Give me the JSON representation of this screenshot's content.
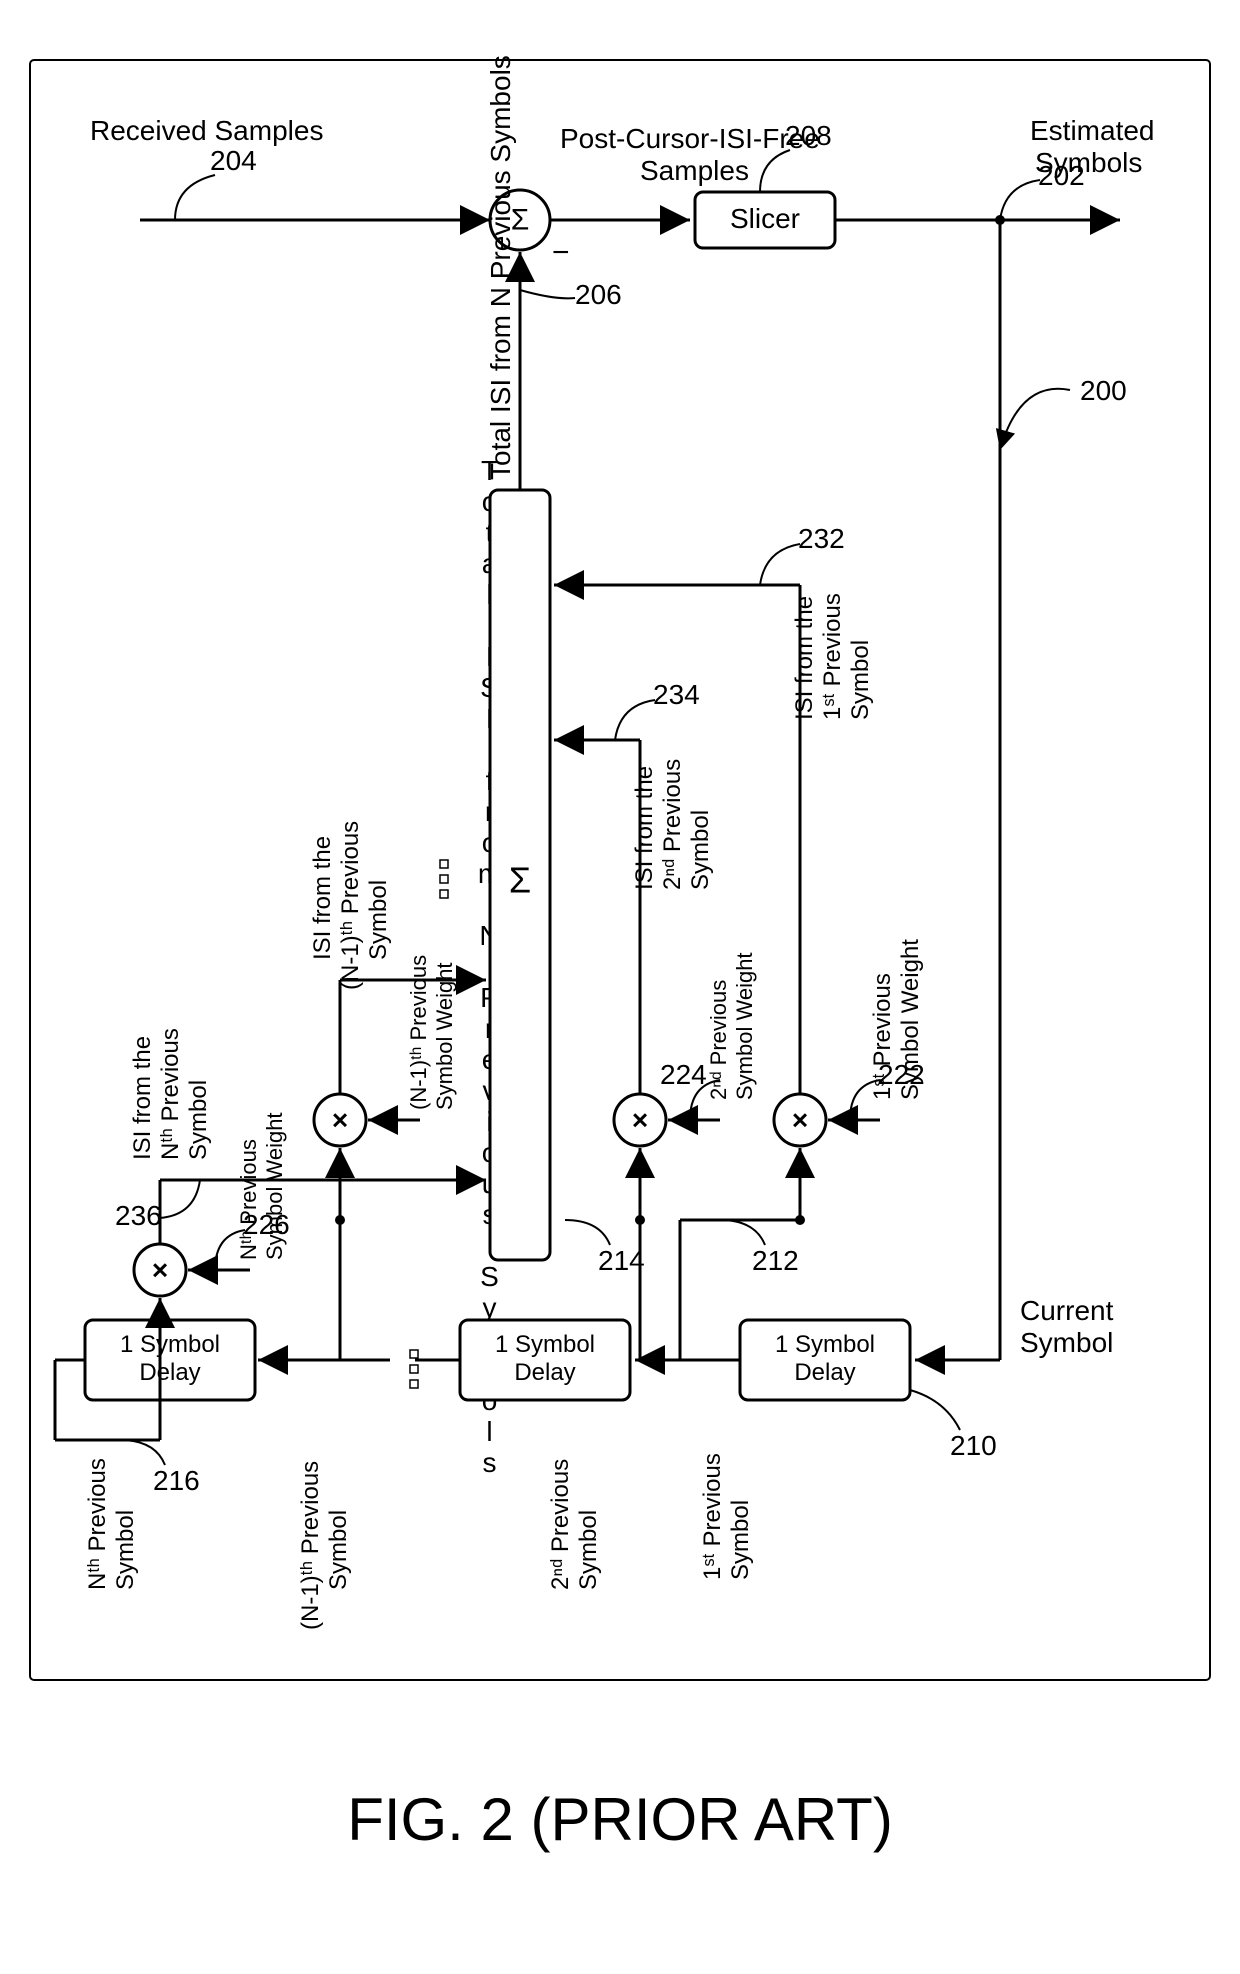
{
  "labels": {
    "received_samples": "Received\nSamples",
    "estimated_symbols": "Estimated\nSymbols",
    "slicer": "Slicer",
    "post_cursor": "Post-Cursor-ISI-Free\nSamples",
    "total_isi": "Total ISI from N Previous Symbols",
    "isi_nth": "ISI from the\nNᵗʰ Previous\nSymbol",
    "isi_nm1": "ISI from the\n(N-1)ᵗʰ Previous\nSymbol",
    "isi_2nd": "ISI from the\n2ⁿᵈ Previous\nSymbol",
    "isi_1st": "ISI from the\n1ˢᵗ Previous\nSymbol",
    "weight_nth": "Nᵗʰ Previous\nSymbol Weight",
    "weight_nm1": "(N-1)ᵗʰ Previous\nSymbol Weight",
    "weight_2nd": "2ⁿᵈ Previous\nSymbol Weight",
    "weight_1st": "1ˢᵗ Previous\nSymbol Weight",
    "delay": "1 Symbol\nDelay",
    "current_symbol": "Current\nSymbol",
    "sym_nth": "Nᵗʰ Previous\nSymbol",
    "sym_nm1": "(N-1)ᵗʰ Previous\nSymbol",
    "sym_2nd": "2ⁿᵈ Previous\nSymbol",
    "sym_1st": "1ˢᵗ Previous\nSymbol",
    "ref_200": "200",
    "ref_202": "202",
    "ref_204": "204",
    "ref_206": "206",
    "ref_208": "208",
    "ref_210": "210",
    "ref_212": "212",
    "ref_214": "214",
    "ref_216": "216",
    "ref_222": "222",
    "ref_224": "224",
    "ref_226": "226",
    "ref_232": "232",
    "ref_234": "234",
    "ref_236": "236",
    "sigma": "Σ",
    "minus": "−",
    "figure_caption": "FIG. 2 (PRIOR ART)"
  }
}
